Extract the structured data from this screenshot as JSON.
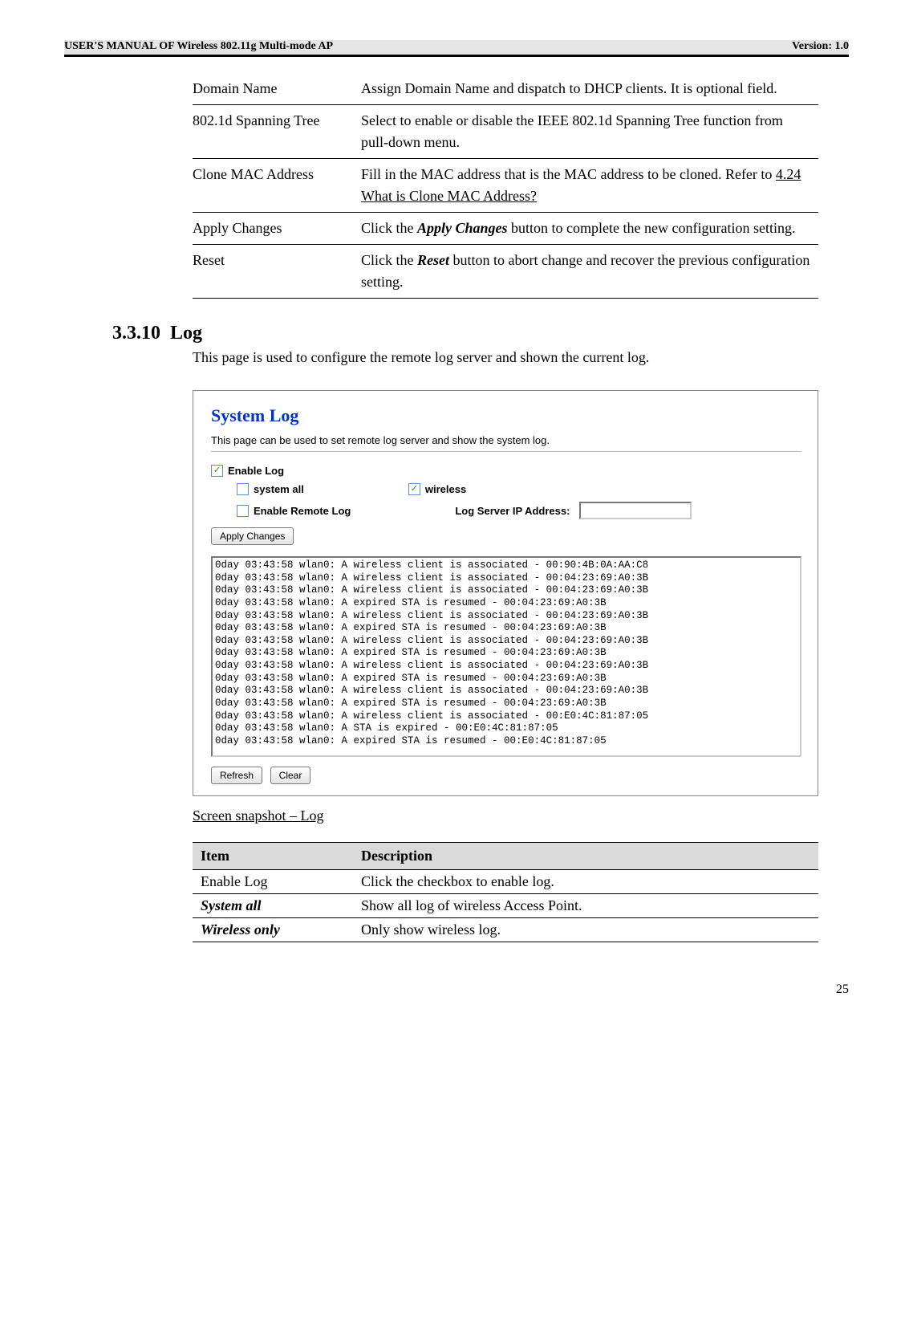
{
  "header": {
    "left": "USER'S MANUAL OF Wireless 802.11g Multi-mode AP",
    "right": "Version: 1.0"
  },
  "params": [
    {
      "name": "Domain Name",
      "desc_parts": [
        "Assign Domain Name and dispatch to DHCP clients. It is optional field."
      ]
    },
    {
      "name": "802.1d Spanning Tree",
      "desc_parts": [
        "Select to enable or disable the IEEE 802.1d Spanning Tree function from pull-down menu."
      ]
    },
    {
      "name": "Clone MAC Address",
      "desc_parts": [
        "Fill in the MAC address that is the MAC address to be cloned. Refer to ",
        {
          "u": "4.24 What is Clone MAC Address?"
        }
      ]
    },
    {
      "name": "Apply Changes",
      "desc_parts": [
        "Click the ",
        {
          "bi": "Apply Changes"
        },
        " button to complete the new configuration setting."
      ]
    },
    {
      "name": "Reset",
      "desc_parts": [
        "Click the ",
        {
          "bi": "Reset"
        },
        " button to abort change and recover the previous configuration setting."
      ]
    }
  ],
  "section": {
    "number": "3.3.10",
    "title": "Log",
    "text": "This page is used to configure the remote log server and shown the current log."
  },
  "syslog": {
    "title": "System Log",
    "desc": "This page can be used to set remote log server and show the system log.",
    "enable_log_label": "Enable Log",
    "enable_log_checked": true,
    "system_all_label": "system all",
    "system_all_checked": false,
    "wireless_label": "wireless",
    "wireless_checked": true,
    "enable_remote_label": "Enable Remote Log",
    "enable_remote_checked": false,
    "server_ip_label": "Log Server IP Address:",
    "apply_btn": "Apply Changes",
    "refresh_btn": "Refresh",
    "clear_btn": "Clear",
    "log_lines": [
      "0day 03:43:58 wlan0: A wireless client is associated - 00:90:4B:0A:AA:C8",
      "0day 03:43:58 wlan0: A wireless client is associated - 00:04:23:69:A0:3B",
      "0day 03:43:58 wlan0: A wireless client is associated - 00:04:23:69:A0:3B",
      "0day 03:43:58 wlan0: A expired STA is resumed - 00:04:23:69:A0:3B",
      "0day 03:43:58 wlan0: A wireless client is associated - 00:04:23:69:A0:3B",
      "0day 03:43:58 wlan0: A expired STA is resumed - 00:04:23:69:A0:3B",
      "0day 03:43:58 wlan0: A wireless client is associated - 00:04:23:69:A0:3B",
      "0day 03:43:58 wlan0: A expired STA is resumed - 00:04:23:69:A0:3B",
      "0day 03:43:58 wlan0: A wireless client is associated - 00:04:23:69:A0:3B",
      "0day 03:43:58 wlan0: A expired STA is resumed - 00:04:23:69:A0:3B",
      "0day 03:43:58 wlan0: A wireless client is associated - 00:04:23:69:A0:3B",
      "0day 03:43:58 wlan0: A expired STA is resumed - 00:04:23:69:A0:3B",
      "0day 03:43:58 wlan0: A wireless client is associated - 00:E0:4C:81:87:05",
      "0day 03:43:58 wlan0: A STA is expired - 00:E0:4C:81:87:05",
      "0day 03:43:58 wlan0: A expired STA is resumed - 00:E0:4C:81:87:05"
    ]
  },
  "caption": "Screen snapshot – Log",
  "item_table": {
    "head": [
      "Item",
      "Description"
    ],
    "rows": [
      {
        "c1": "Enable Log",
        "c1_style": "",
        "c2": "Click the checkbox to enable log."
      },
      {
        "c1": "System all",
        "c1_style": "bi",
        "c2": "Show all log of wireless Access Point."
      },
      {
        "c1": "Wireless only",
        "c1_style": "bi",
        "c2": "Only show wireless log."
      }
    ]
  },
  "page_number": "25"
}
